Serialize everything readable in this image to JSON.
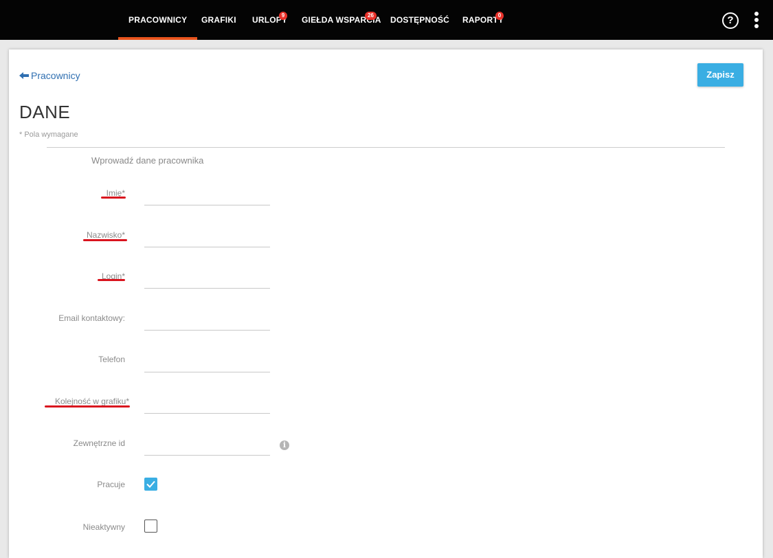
{
  "nav": {
    "items": [
      {
        "label": "PRACOWNICY",
        "badge": null,
        "active": true
      },
      {
        "label": "GRAFIKI",
        "badge": null,
        "active": false
      },
      {
        "label": "URLOPY",
        "badge": "9",
        "active": false
      },
      {
        "label": "GIEŁDA WSPARCIA",
        "badge": "26",
        "active": false
      },
      {
        "label": "DOSTĘPNOŚĆ",
        "badge": null,
        "active": false
      },
      {
        "label": "RAPORTY",
        "badge": "0",
        "active": false
      }
    ],
    "help_glyph": "?",
    "accent_color": "#e8541d",
    "badge_color": "#e8312a"
  },
  "page": {
    "back_label": "Pracownicy",
    "save_label": "Zapisz",
    "title": "DANE",
    "required_note": "* Pola wymagane",
    "section_hint": "Wprowadź dane pracownika"
  },
  "form": {
    "first_name": {
      "label": "Imię*",
      "value": ""
    },
    "last_name": {
      "label": "Nazwisko*",
      "value": ""
    },
    "login": {
      "label": "Login*",
      "value": ""
    },
    "email": {
      "label": "Email kontaktowy:",
      "value": ""
    },
    "phone": {
      "label": "Telefon",
      "value": ""
    },
    "order": {
      "label": "Kolejność w grafiku*",
      "value": ""
    },
    "external_id": {
      "label": "Zewnętrzne id",
      "value": ""
    },
    "working": {
      "label": "Pracuje",
      "checked": true
    },
    "inactive": {
      "label": "Nieaktywny",
      "checked": false
    }
  },
  "icons": {
    "back": "arrow-left-icon",
    "help": "help-circle-icon",
    "menu": "kebab-menu-icon",
    "info": "info-icon",
    "check": "checkmark-icon"
  },
  "colors": {
    "primary_button": "#3aaee3",
    "link": "#2f6fb1",
    "annotation_underline": "#d9141e"
  }
}
